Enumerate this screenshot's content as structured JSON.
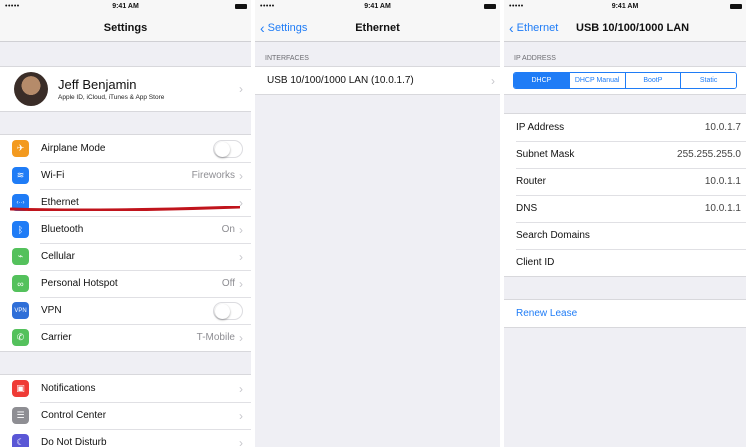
{
  "status": {
    "signal": "•••••",
    "time": "9:41 AM"
  },
  "colors": {
    "accent": "#1f7cf6",
    "annotation": "#c0141c"
  },
  "p1": {
    "title": "Settings",
    "profile": {
      "name": "Jeff Benjamin",
      "subtitle": "Apple ID, iCloud, iTunes & App Store"
    },
    "group1": [
      {
        "label": "Airplane Mode",
        "icon": "airplane-icon",
        "color": "#f39a1f",
        "glyph": "✈",
        "value": "",
        "toggle": true
      },
      {
        "label": "Wi-Fi",
        "icon": "wifi-icon",
        "color": "#1f7cf6",
        "glyph": "≋",
        "value": "Fireworks",
        "toggle": false
      },
      {
        "label": "Ethernet",
        "icon": "ethernet-icon",
        "color": "#1f7cf6",
        "glyph": "‹··›",
        "value": "",
        "toggle": false
      },
      {
        "label": "Bluetooth",
        "icon": "bluetooth-icon",
        "color": "#1f7cf6",
        "glyph": "ᛒ",
        "value": "On",
        "toggle": false
      },
      {
        "label": "Cellular",
        "icon": "cellular-icon",
        "color": "#54c15c",
        "glyph": "⌁",
        "value": "",
        "toggle": false
      },
      {
        "label": "Personal Hotspot",
        "icon": "hotspot-icon",
        "color": "#54c15c",
        "glyph": "∞",
        "value": "Off",
        "toggle": false
      },
      {
        "label": "VPN",
        "icon": "vpn-icon",
        "color": "#2f6fd8",
        "glyph": "VPN",
        "value": "",
        "toggle": true
      },
      {
        "label": "Carrier",
        "icon": "phone-icon",
        "color": "#54c15c",
        "glyph": "✆",
        "value": "T-Mobile",
        "toggle": false
      }
    ],
    "group2": [
      {
        "label": "Notifications",
        "icon": "notifications-icon",
        "color": "#ef3b36",
        "glyph": "▣"
      },
      {
        "label": "Control Center",
        "icon": "control-center-icon",
        "color": "#8e8e93",
        "glyph": "☰"
      },
      {
        "label": "Do Not Disturb",
        "icon": "moon-icon",
        "color": "#5a57d6",
        "glyph": "☾"
      }
    ]
  },
  "p2": {
    "back": "Settings",
    "title": "Ethernet",
    "section": "INTERFACES",
    "interface": "USB 10/100/1000 LAN (10.0.1.7)"
  },
  "p3": {
    "back": "Ethernet",
    "title": "USB 10/100/1000 LAN",
    "section": "IP ADDRESS",
    "segments": [
      "DHCP",
      "DHCP Manual",
      "BootP",
      "Static"
    ],
    "selected_segment": "DHCP",
    "details": [
      {
        "label": "IP Address",
        "value": "10.0.1.7"
      },
      {
        "label": "Subnet Mask",
        "value": "255.255.255.0"
      },
      {
        "label": "Router",
        "value": "10.0.1.1"
      },
      {
        "label": "DNS",
        "value": "10.0.1.1"
      },
      {
        "label": "Search Domains",
        "value": ""
      },
      {
        "label": "Client ID",
        "value": ""
      }
    ],
    "renew": "Renew Lease"
  }
}
